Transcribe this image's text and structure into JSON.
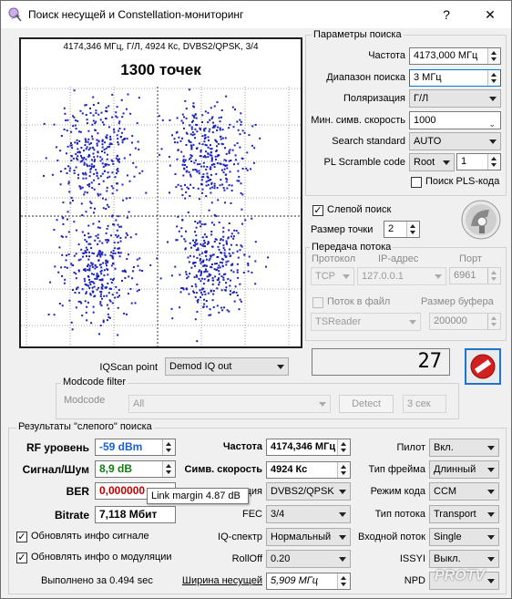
{
  "window": {
    "title": "Поиск несущей и Constellation-мониторинг",
    "help": "?",
    "close": "✕"
  },
  "constellation": {
    "info": "4174,346 МГц, Г/Л, 4924 Кс, DVBS2/QPSK, 3/4",
    "points_label": "1300 точек"
  },
  "search_params": {
    "title": "Параметры поиска",
    "freq_label": "Частота",
    "freq_value": "4173,000 МГц",
    "range_label": "Диапазон поиска",
    "range_value": "3 МГц",
    "pol_label": "Поляризация",
    "pol_value": "Г/Л",
    "minsr_label": "Мин. симв. скорость",
    "minsr_value": "1000",
    "std_label": "Search standard",
    "std_value": "AUTO",
    "pls_label": "PL Scramble code",
    "pls_mode": "Root",
    "pls_value": "1",
    "pls_search_label": "Поиск PLS-кода"
  },
  "blind": {
    "label": "Слепой поиск",
    "dot_size_label": "Размер точки",
    "dot_size_value": "2"
  },
  "stream": {
    "title": "Передача потока",
    "proto_label": "Протокол",
    "ip_label": "IP-адрес",
    "port_label": "Порт",
    "proto_value": "TCP",
    "ip_value": "127.0.0.1",
    "port_value": "6961",
    "to_file_label": "Поток в файл",
    "buffer_label": "Размер буфера",
    "format_value": "TSReader",
    "buffer_value": "200000"
  },
  "counter": "27",
  "iqscan": {
    "label": "IQScan point",
    "value": "Demod IQ out"
  },
  "modcode": {
    "title": "Modcode filter",
    "label": "Modcode",
    "value": "All",
    "detect_label": "Detect",
    "time_value": "3 сек"
  },
  "results": {
    "title": "Результаты \"слепого\" поиска",
    "rf_label": "RF уровень",
    "rf_value": "-59 dBm",
    "snr_label": "Сигнал/Шум",
    "snr_value": "8,9 dB",
    "ber_label": "BER",
    "ber_value": "0,000000",
    "bitrate_label": "Bitrate",
    "bitrate_value": "7,118 Мбит",
    "freq_label": "Частота",
    "freq_value": "4174,346 МГц",
    "sr_label": "Симв. скорость",
    "sr_value": "4924 Кс",
    "mod_label": "ция",
    "mod_value": "DVBS2/QPSK",
    "fec_label": "FEC",
    "fec_value": "3/4",
    "iq_label": "IQ-спектр",
    "iq_value": "Нормальный",
    "rolloff_label": "RollOff",
    "rolloff_value": "0.20",
    "bw_label": "Ширина несущей",
    "bw_value": "5,909 МГц",
    "pilot_label": "Пилот",
    "pilot_value": "Вкл.",
    "frame_label": "Тип фрейма",
    "frame_value": "Длинный",
    "mode_label": "Режим кода",
    "mode_value": "CCM",
    "stype_label": "Тип потока",
    "stype_value": "Transport",
    "input_label": "Входной поток",
    "input_value": "Single",
    "issyi_label": "ISSYI",
    "issyi_value": "Выкл.",
    "npd_label": "NPD",
    "update_signal_label": "Обновлять инфо сигнале",
    "update_mod_label": "Обновлять инфо о модуляции",
    "done_label": "Выполнено за 0.494 sec",
    "tooltip": "Link margin 4.87 dB"
  },
  "watermark": "PROTV",
  "colors": {
    "dots": "#1a22b8",
    "blue_value": "#1a5fd0",
    "green_value": "#147a14",
    "red_value": "#c00000",
    "stop": "#d21f1f"
  },
  "icons": [
    "app-icon",
    "satellite-dish-icon",
    "stop-icon"
  ]
}
